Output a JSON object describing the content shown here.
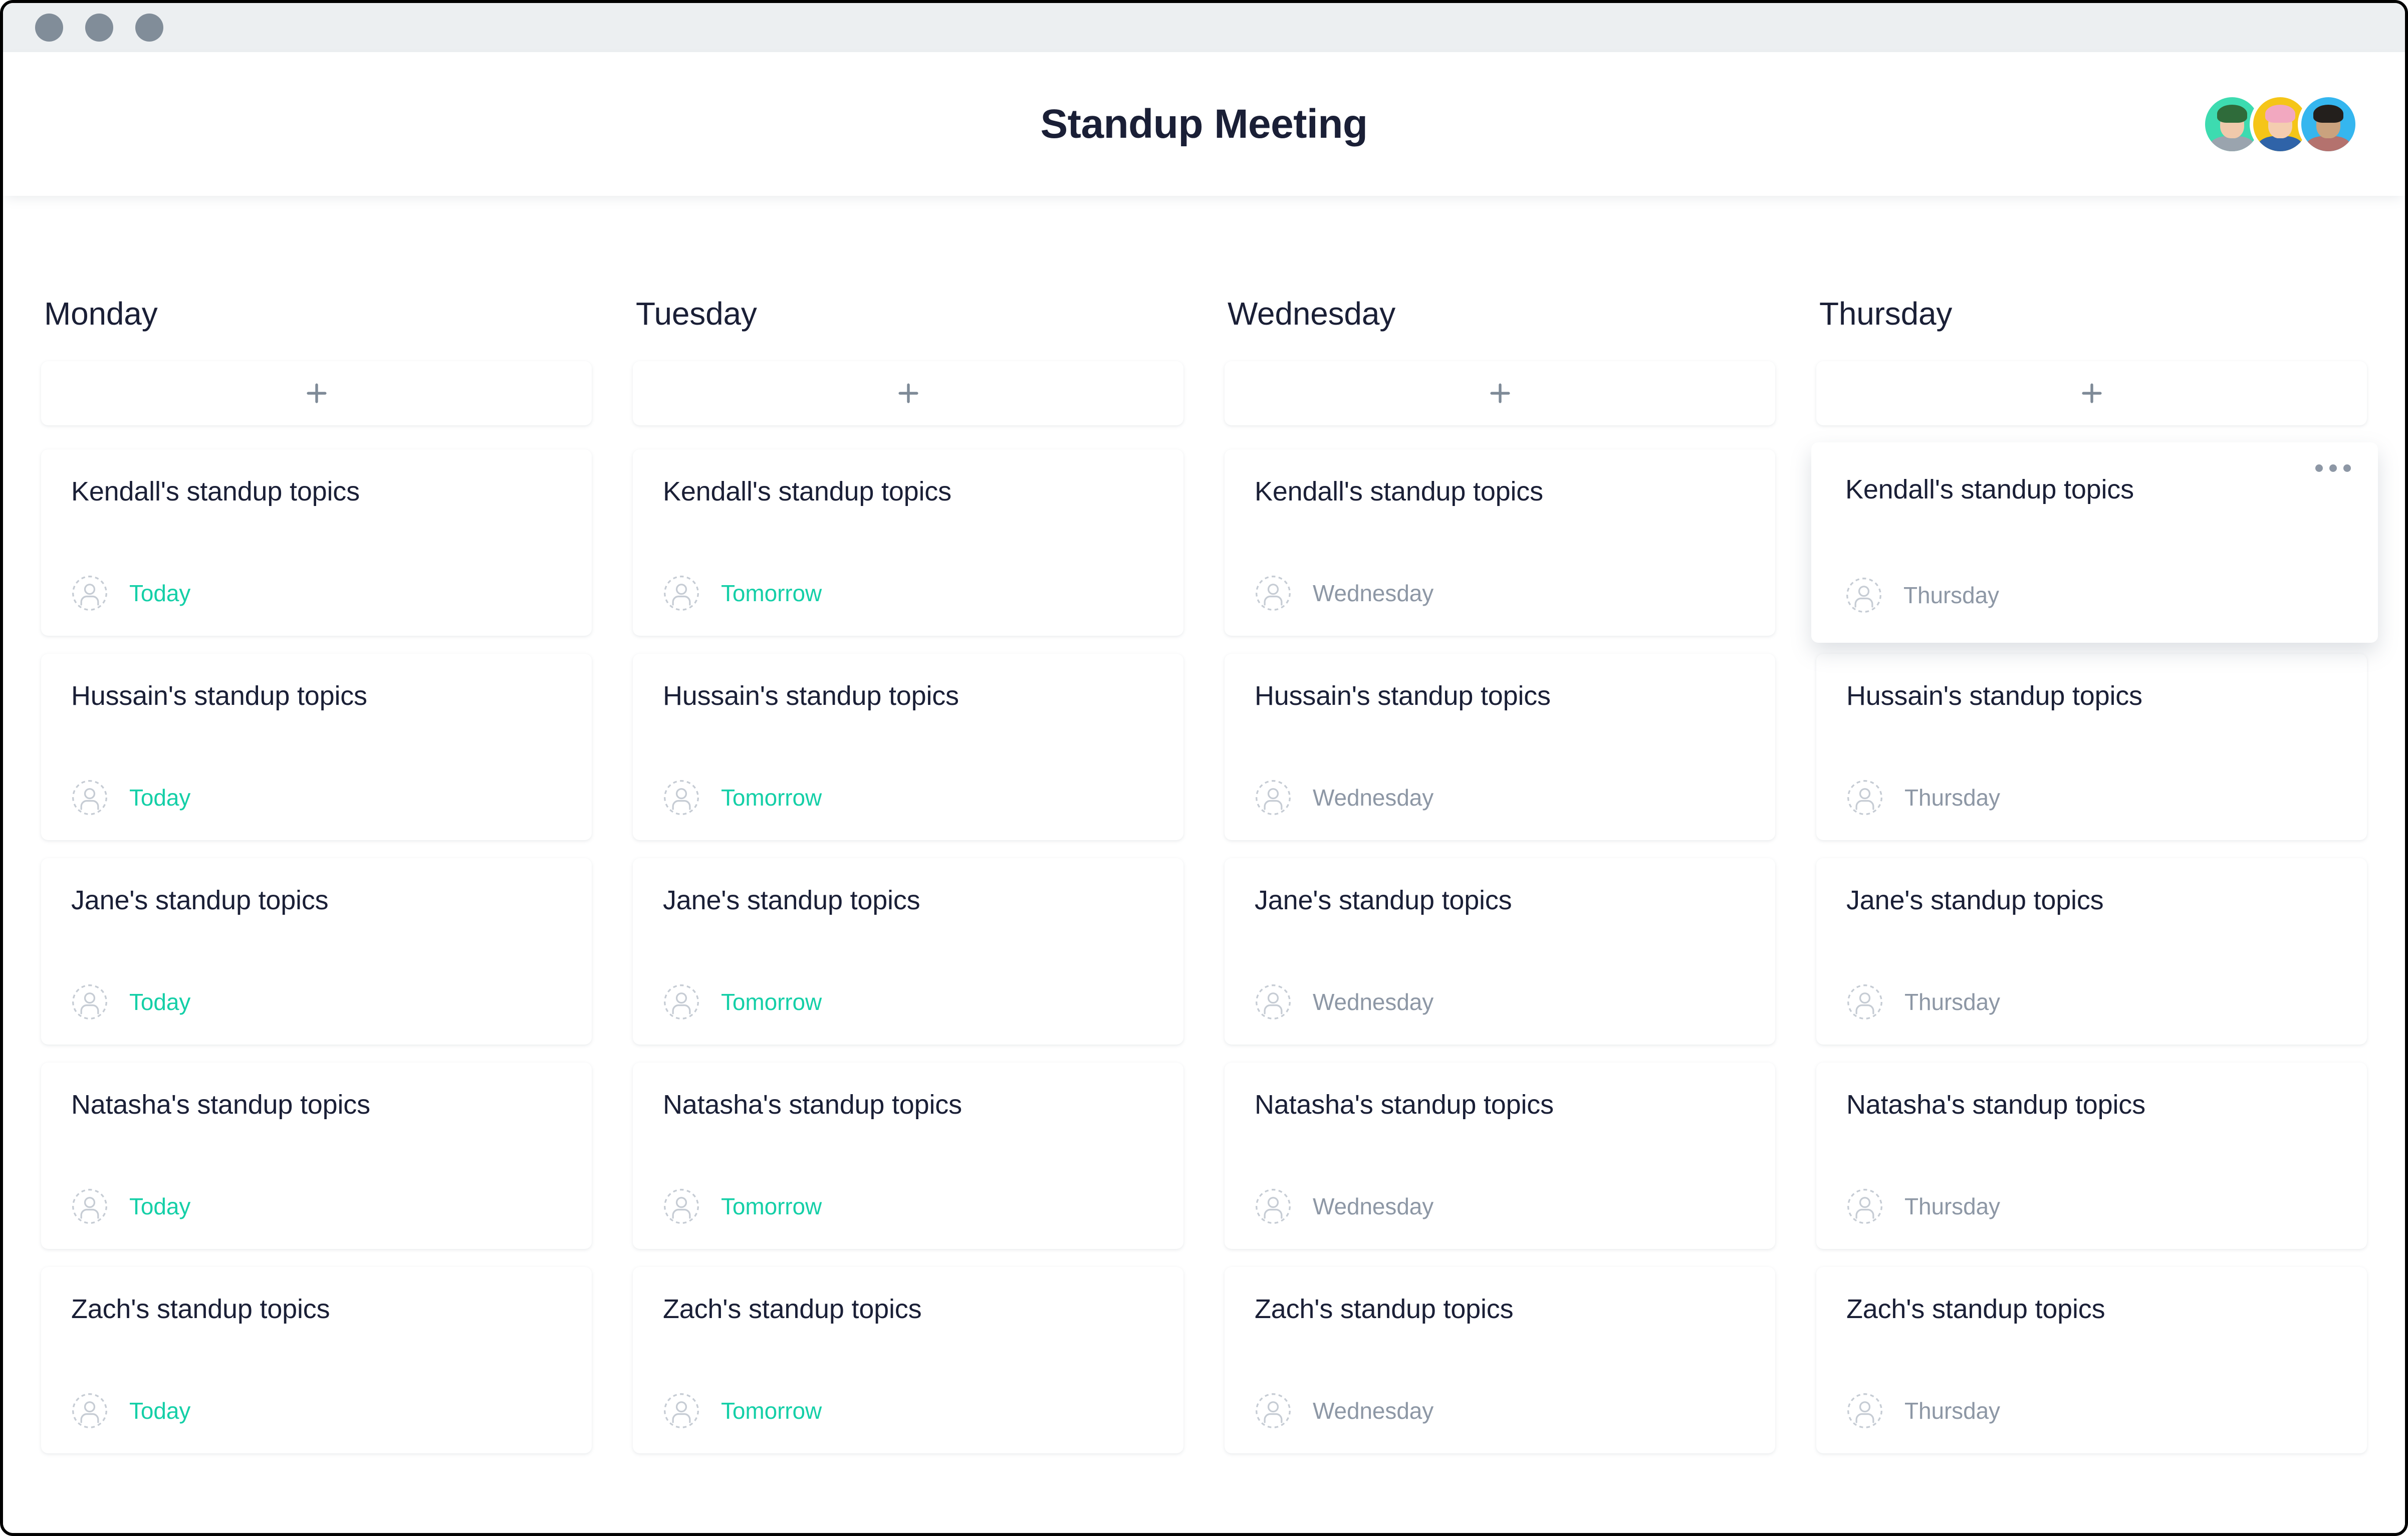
{
  "window": {
    "traffic_lights": [
      "close",
      "minimize",
      "zoom"
    ]
  },
  "header": {
    "title": "Standup Meeting",
    "avatars": [
      {
        "name": "avatar-teal",
        "bg": "#3ddbb0",
        "hair": "#2f6b3a",
        "skin": "#f0c9ab",
        "body": "#9aa4ae"
      },
      {
        "name": "avatar-yellow",
        "bg": "#f5c518",
        "hair": "#f2a8c0",
        "skin": "#f4cdb0",
        "body": "#2f63a8"
      },
      {
        "name": "avatar-blue",
        "bg": "#35b6ef",
        "hair": "#231f1c",
        "skin": "#caa27e",
        "body": "#b4726e"
      }
    ]
  },
  "board": {
    "add_card_icon": "plus-icon",
    "menu_icon": "ellipsis-icon",
    "assignee_icon": "user-placeholder-icon",
    "accent_color": "#14cfa7",
    "muted_color": "#8d97a5",
    "columns": [
      {
        "title": "Monday",
        "add_label": "+",
        "cards": [
          {
            "title": "Kendall's standup topics",
            "date": "Today",
            "date_style": "accent",
            "menu": false,
            "elevated": false
          },
          {
            "title": "Hussain's standup topics",
            "date": "Today",
            "date_style": "accent",
            "menu": false,
            "elevated": false
          },
          {
            "title": "Jane's standup topics",
            "date": "Today",
            "date_style": "accent",
            "menu": false,
            "elevated": false
          },
          {
            "title": "Natasha's standup topics",
            "date": "Today",
            "date_style": "accent",
            "menu": false,
            "elevated": false
          },
          {
            "title": "Zach's standup topics",
            "date": "Today",
            "date_style": "accent",
            "menu": false,
            "elevated": false
          }
        ]
      },
      {
        "title": "Tuesday",
        "add_label": "+",
        "cards": [
          {
            "title": "Kendall's standup topics",
            "date": "Tomorrow",
            "date_style": "accent",
            "menu": false,
            "elevated": false
          },
          {
            "title": "Hussain's standup topics",
            "date": "Tomorrow",
            "date_style": "accent",
            "menu": false,
            "elevated": false
          },
          {
            "title": "Jane's standup topics",
            "date": "Tomorrow",
            "date_style": "accent",
            "menu": false,
            "elevated": false
          },
          {
            "title": "Natasha's standup topics",
            "date": "Tomorrow",
            "date_style": "accent",
            "menu": false,
            "elevated": false
          },
          {
            "title": "Zach's standup topics",
            "date": "Tomorrow",
            "date_style": "accent",
            "menu": false,
            "elevated": false
          }
        ]
      },
      {
        "title": "Wednesday",
        "add_label": "+",
        "cards": [
          {
            "title": "Kendall's standup topics",
            "date": "Wednesday",
            "date_style": "muted",
            "menu": false,
            "elevated": false
          },
          {
            "title": "Hussain's standup topics",
            "date": "Wednesday",
            "date_style": "muted",
            "menu": false,
            "elevated": false
          },
          {
            "title": "Jane's standup topics",
            "date": "Wednesday",
            "date_style": "muted",
            "menu": false,
            "elevated": false
          },
          {
            "title": "Natasha's standup topics",
            "date": "Wednesday",
            "date_style": "muted",
            "menu": false,
            "elevated": false
          },
          {
            "title": "Zach's standup topics",
            "date": "Wednesday",
            "date_style": "muted",
            "menu": false,
            "elevated": false
          }
        ]
      },
      {
        "title": "Thursday",
        "add_label": "+",
        "cards": [
          {
            "title": "Kendall's standup topics",
            "date": "Thursday",
            "date_style": "muted",
            "menu": true,
            "elevated": true
          },
          {
            "title": "Hussain's standup topics",
            "date": "Thursday",
            "date_style": "muted",
            "menu": false,
            "elevated": false
          },
          {
            "title": "Jane's standup topics",
            "date": "Thursday",
            "date_style": "muted",
            "menu": false,
            "elevated": false
          },
          {
            "title": "Natasha's standup topics",
            "date": "Thursday",
            "date_style": "muted",
            "menu": false,
            "elevated": false
          },
          {
            "title": "Zach's standup topics",
            "date": "Thursday",
            "date_style": "muted",
            "menu": false,
            "elevated": false
          }
        ]
      }
    ]
  }
}
